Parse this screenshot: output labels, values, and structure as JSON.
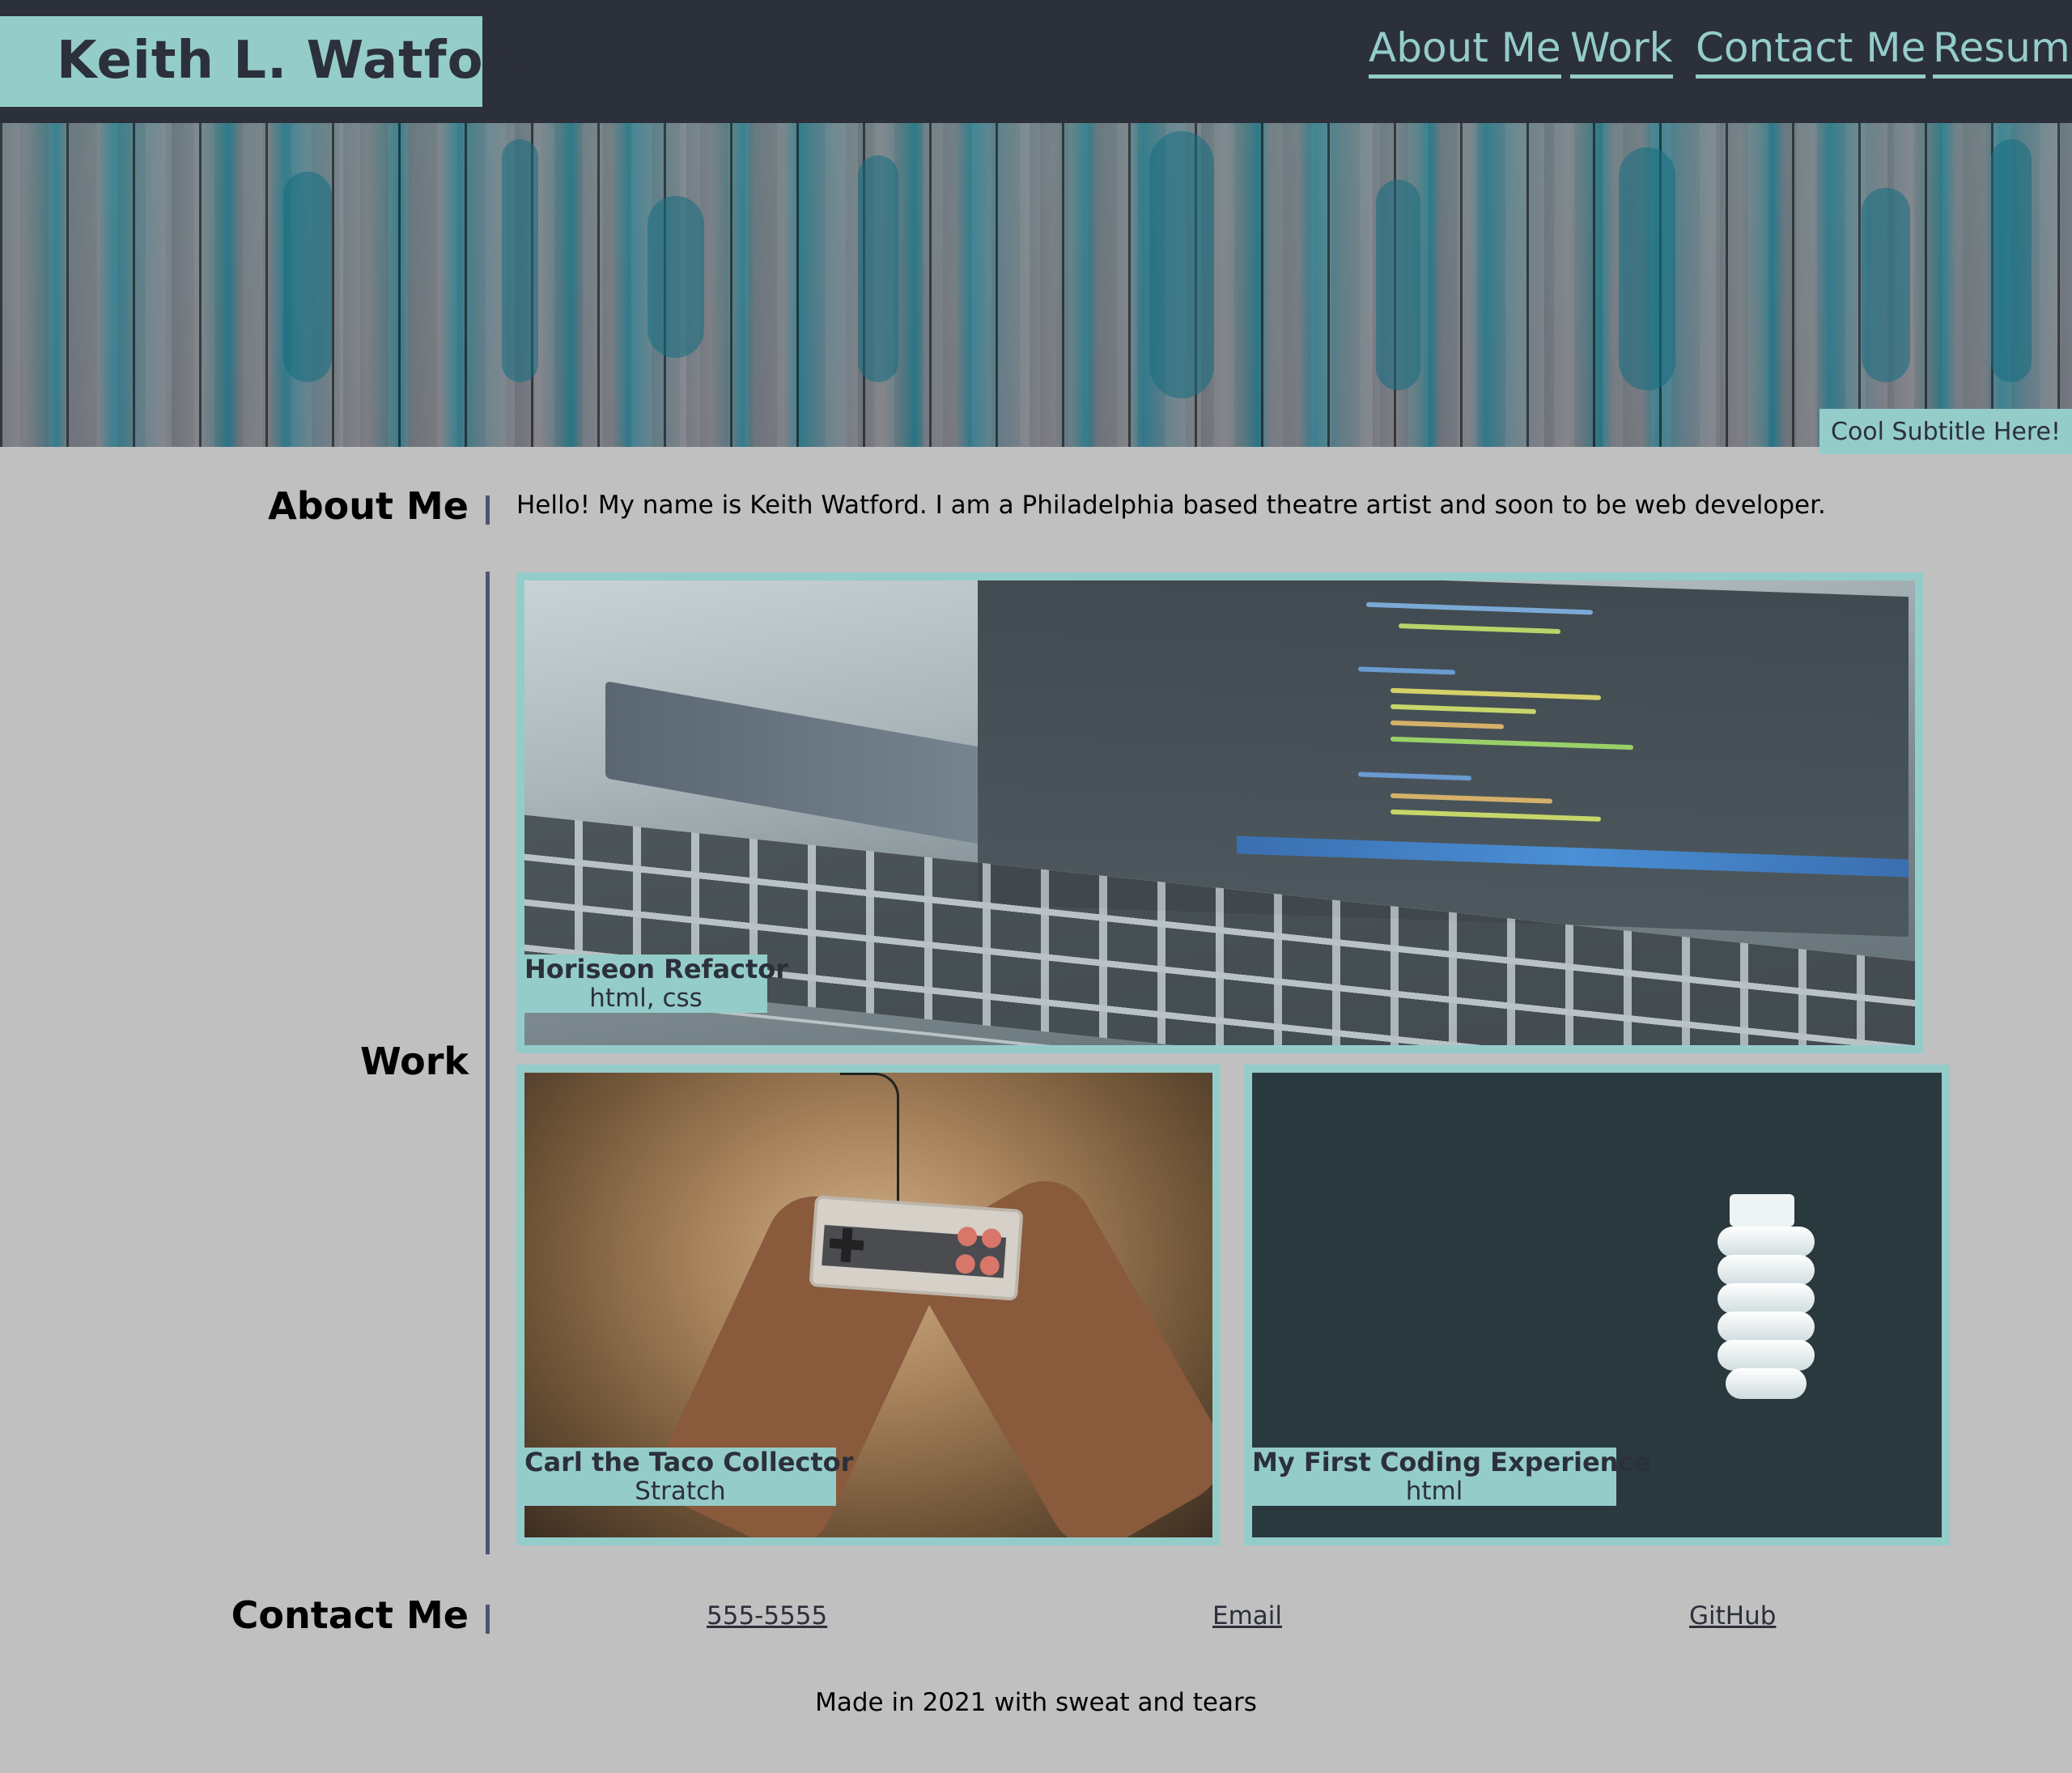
{
  "header": {
    "name": "Keith L. Watford",
    "nav": [
      "About Me",
      "Work",
      "Contact Me",
      "Resume"
    ]
  },
  "hero": {
    "subtitle": "Cool Subtitle Here!"
  },
  "about": {
    "heading": "About Me",
    "text": "Hello! My name is Keith Watford. I am a Philadelphia based theatre artist and soon to be web developer."
  },
  "work": {
    "heading": "Work",
    "projects": [
      {
        "title": "Horiseon Refactor",
        "tech": "html, css",
        "image": "laptop-code-photo"
      },
      {
        "title": "Carl the Taco Collector",
        "tech": "Stratch",
        "image": "game-controller-photo"
      },
      {
        "title": "My First Coding Experience",
        "tech": "html",
        "image": "light-bulb-photo"
      }
    ]
  },
  "contact": {
    "heading": "Contact Me",
    "phone": "555-5555",
    "email": "Email",
    "github": "GitHub"
  },
  "footer": {
    "text": "Made in 2021 with sweat and tears"
  },
  "colors": {
    "accent": "#94ccca",
    "header_bg": "#2c303a",
    "page_bg": "#c0c0c0",
    "divider": "#4d5670"
  }
}
